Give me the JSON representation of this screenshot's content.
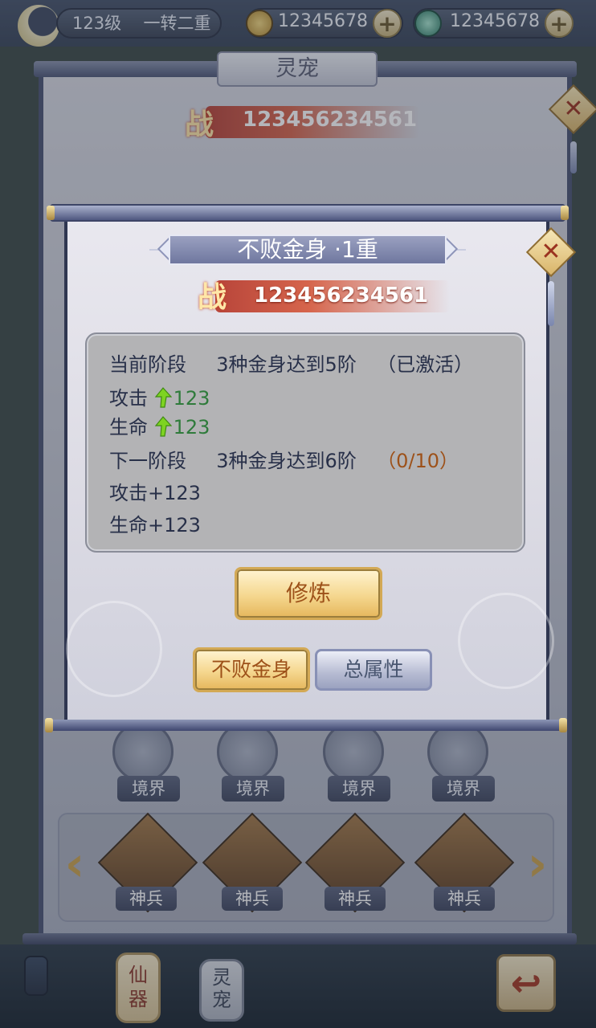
{
  "topbar": {
    "level": "123级",
    "rank": "一转二重",
    "gold": "12345678",
    "jade": "12345678",
    "plus": "+"
  },
  "background": {
    "title": "灵宠",
    "power": "123456234561",
    "close": "✕",
    "slot_label": "境界",
    "slot_labels": [
      "境界",
      "境界",
      "境界",
      "境界"
    ],
    "items": [
      {
        "label": "神兵",
        "icon": "cauldron-icon"
      },
      {
        "label": "神兵",
        "icon": "gauntlet-icon"
      },
      {
        "label": "神兵",
        "icon": "scroll-icon"
      },
      {
        "label": "神兵",
        "icon": "book-icon"
      }
    ],
    "scroll_left": "‹",
    "scroll_right": "›"
  },
  "bottom_nav": {
    "tab1": "仙器",
    "tab2": "灵宠",
    "back": "↩"
  },
  "dialog": {
    "title": "不败金身 ·1重",
    "close": "✕",
    "battle_glyph": "战",
    "power": "123456234561",
    "current_stage_label": "当前阶段",
    "current_stage_req": "3种金身达到5阶",
    "current_stage_status": "（已激活）",
    "current_attack_label": "攻击",
    "current_attack_value": "123",
    "current_hp_label": "生命",
    "current_hp_value": "123",
    "next_stage_label": "下一阶段",
    "next_stage_req": "3种金身达到6阶",
    "next_stage_progress": "（0/10）",
    "next_attack": "攻击+123",
    "next_hp": "生命+123",
    "cultivate_button": "修炼",
    "tab_body": "不败金身",
    "tab_total": "总属性"
  },
  "colors": {
    "cultivate_text": "#9d5119",
    "tab_body_text": "#9d5119",
    "tab_total_text": "#495670",
    "stat_green": "#2f7b3b",
    "progress_brown": "#9d5119"
  }
}
